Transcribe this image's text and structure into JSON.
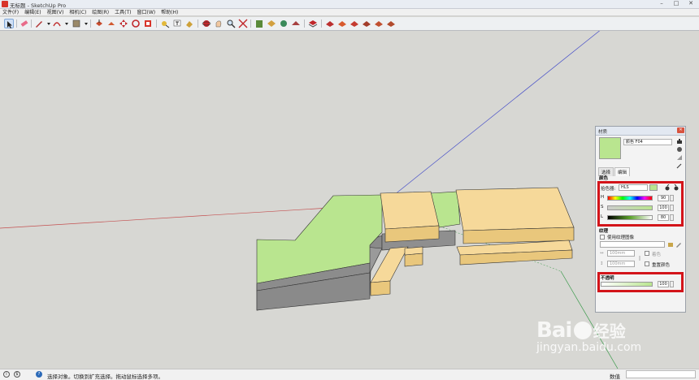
{
  "window": {
    "title": "无标题 - SketchUp Pro",
    "controls": [
      "–",
      "□",
      "✕"
    ]
  },
  "menu": {
    "items": [
      "文件(F)",
      "编辑(E)",
      "视图(V)",
      "相机(C)",
      "绘图(R)",
      "工具(T)",
      "窗口(W)",
      "帮助(H)"
    ]
  },
  "toolbar": {
    "tools": [
      "select-icon",
      "eraser-icon",
      "pencil-icon",
      "dropdown-icon",
      "arc-icon",
      "dropdown-icon",
      "rectangle-icon",
      "dropdown-icon",
      "push-pull-icon",
      "follow-me-icon",
      "move-icon",
      "rotate-icon",
      "scale-icon",
      "tape-icon",
      "text-icon",
      "paint-icon",
      "orbit-icon",
      "pan-icon",
      "zoom-icon",
      "zoom-extents-icon",
      "warehouse-icon",
      "extension-icon",
      "components-icon",
      "styles-icon",
      "layers-icon",
      "shadows-icon",
      "scenes-icon",
      "section-icon",
      "xray-icon"
    ]
  },
  "materials_panel": {
    "title": "材质",
    "material_name": "颜色 F04",
    "swatch_color": "#b9e58f",
    "tabs": [
      "选择",
      "编辑"
    ],
    "active_tab": "编辑",
    "color_section": "颜色",
    "picker_label": "拾色器:",
    "picker_value": "HLS",
    "h_label": "H",
    "h_value": "90",
    "s_label": "S",
    "s_value": "100",
    "l_label": "L",
    "l_value": "80",
    "texture_section": "纹理",
    "use_texture_label": "使用纹理图像",
    "width_value": "100mm",
    "height_value": "100mm",
    "colorize_label": "着色",
    "reset_color_label": "重置颜色",
    "opacity_section": "不透明",
    "opacity_value": "100"
  },
  "status": {
    "message": "选择对象。切换到扩充选择。拖动鼠标选择多项。",
    "value_label": "数值",
    "value": ""
  },
  "watermark": {
    "brand": "Bai",
    "brand_tail": "经验",
    "url": "jingyan.baidu.com"
  },
  "colors": {
    "accent_red": "#d3141a",
    "green_face": "#b9e58f",
    "yellow_face": "#f6d99a"
  }
}
